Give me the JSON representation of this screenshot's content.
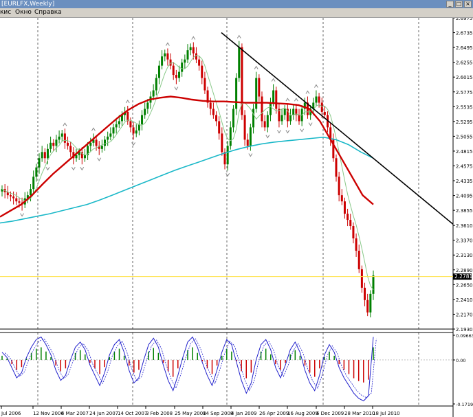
{
  "window": {
    "title": "[EURLFX,Weekly]",
    "buttons": [
      "_",
      "□",
      "×"
    ]
  },
  "menu": {
    "items": [
      "кис",
      "Окно",
      "Справка"
    ]
  },
  "colors": {
    "background": "#ffffff",
    "bull_candle": "#008000",
    "bear_candle": "#cc0000",
    "ma_red": "#cc0000",
    "ma_cyan": "#1ab8c8",
    "ma_thin": "#88c888",
    "trendline": "#000000",
    "current_price_line": "#ffe24a",
    "oscillator_line": "#2020cc"
  },
  "chart_data": [
    {
      "type": "candlestick",
      "symbol": "EURLFX",
      "timeframe": "Weekly",
      "ylim": [
        2.193,
        2.6975
      ],
      "y_ticks": [
        "2.6975",
        "2.6735",
        "2.6495",
        "2.6255",
        "2.6015",
        "2.5775",
        "2.5535",
        "2.5295",
        "2.5055",
        "2.4815",
        "2.4575",
        "2.4335",
        "2.4095",
        "2.3855",
        "2.3610",
        "2.3370",
        "2.3130",
        "2.2890",
        "2.2650",
        "2.2410",
        "2.2170",
        "2.1930"
      ],
      "current_price": 2.2781,
      "current_price_label": "2.2781",
      "x_labels": [
        "Jul 2006",
        "12 Nov 2006",
        "4 Mar 2007",
        "24 Jun 2007",
        "14 Oct 2007",
        "3 Feb 2008",
        "25 May 2008",
        "14 Sep 2008",
        "4 Jan 2009",
        "26 Apr 2009",
        "16 Aug 2009",
        "6 Dec 2009",
        "28 Mar 2010",
        "18 Jul 2010"
      ],
      "grid": "vertical dashed",
      "closes": [
        2.42,
        2.415,
        2.41,
        2.408,
        2.405,
        2.4,
        2.398,
        2.395,
        2.405,
        2.41,
        2.42,
        2.44,
        2.455,
        2.47,
        2.48,
        2.47,
        2.485,
        2.495,
        2.49,
        2.5,
        2.505,
        2.51,
        2.495,
        2.49,
        2.48,
        2.47,
        2.475,
        2.48,
        2.47,
        2.475,
        2.49,
        2.495,
        2.5,
        2.49,
        2.485,
        2.49,
        2.5,
        2.505,
        2.51,
        2.52,
        2.525,
        2.53,
        2.54,
        2.545,
        2.53,
        2.52,
        2.51,
        2.515,
        2.525,
        2.54,
        2.55,
        2.56,
        2.57,
        2.58,
        2.6,
        2.62,
        2.635,
        2.64,
        2.63,
        2.62,
        2.605,
        2.6,
        2.61,
        2.625,
        2.63,
        2.645,
        2.65,
        2.64,
        2.63,
        2.62,
        2.6,
        2.58,
        2.56,
        2.55,
        2.54,
        2.53,
        2.51,
        2.48,
        2.46,
        2.49,
        2.52,
        2.55,
        2.6,
        2.65,
        2.54,
        2.5,
        2.49,
        2.52,
        2.55,
        2.6,
        2.57,
        2.53,
        2.52,
        2.54,
        2.56,
        2.58,
        2.55,
        2.53,
        2.54,
        2.55,
        2.53,
        2.54,
        2.55,
        2.54,
        2.53,
        2.55,
        2.56,
        2.54,
        2.55,
        2.56,
        2.57,
        2.56,
        2.545,
        2.54,
        2.52,
        2.5,
        2.47,
        2.44,
        2.41,
        2.4,
        2.38,
        2.37,
        2.36,
        2.34,
        2.32,
        2.29,
        2.26,
        2.24,
        2.22,
        2.25,
        2.28
      ],
      "ma_red": [
        2.375,
        2.385,
        2.395,
        2.41,
        2.428,
        2.445,
        2.46,
        2.475,
        2.49,
        2.505,
        2.52,
        2.535,
        2.548,
        2.558,
        2.565,
        2.568,
        2.57,
        2.568,
        2.565,
        2.563,
        2.562,
        2.562,
        2.561,
        2.56,
        2.56,
        2.56,
        2.559,
        2.558,
        2.556,
        2.55,
        2.53,
        2.5,
        2.47,
        2.44,
        2.41,
        2.395
      ],
      "ma_cyan": [
        2.365,
        2.368,
        2.372,
        2.376,
        2.38,
        2.385,
        2.39,
        2.395,
        2.402,
        2.41,
        2.418,
        2.426,
        2.434,
        2.442,
        2.45,
        2.457,
        2.464,
        2.471,
        2.478,
        2.484,
        2.489,
        2.493,
        2.496,
        2.498,
        2.5,
        2.502,
        2.504,
        2.5,
        2.492,
        2.48,
        2.47
      ]
    },
    {
      "type": "line",
      "name": "",
      "ylim": [
        -0.1719,
        0.0966
      ],
      "y_ticks": [
        "0.09663",
        "0.00",
        "-0.17191"
      ],
      "values": [
        0.03,
        0.01,
        -0.03,
        -0.07,
        -0.05,
        0.01,
        0.05,
        0.08,
        0.09,
        0.06,
        0.02,
        -0.04,
        -0.08,
        -0.06,
        0.0,
        0.05,
        0.07,
        0.04,
        -0.02,
        -0.06,
        -0.1,
        -0.05,
        0.02,
        0.06,
        0.08,
        0.03,
        -0.04,
        -0.09,
        -0.07,
        0.0,
        0.06,
        0.085,
        0.05,
        -0.02,
        -0.08,
        -0.12,
        -0.06,
        0.01,
        0.07,
        0.09,
        0.05,
        -0.01,
        -0.06,
        -0.1,
        -0.04,
        0.03,
        0.08,
        0.06,
        -0.01,
        -0.08,
        -0.13,
        -0.09,
        0.0,
        0.06,
        0.08,
        0.04,
        -0.03,
        -0.07,
        -0.02,
        0.04,
        0.07,
        0.03,
        -0.04,
        -0.09,
        -0.12,
        -0.06,
        0.02,
        0.06,
        0.03,
        -0.03,
        -0.07,
        -0.1,
        -0.13,
        -0.15,
        -0.16,
        -0.14,
        0.09
      ]
    }
  ]
}
